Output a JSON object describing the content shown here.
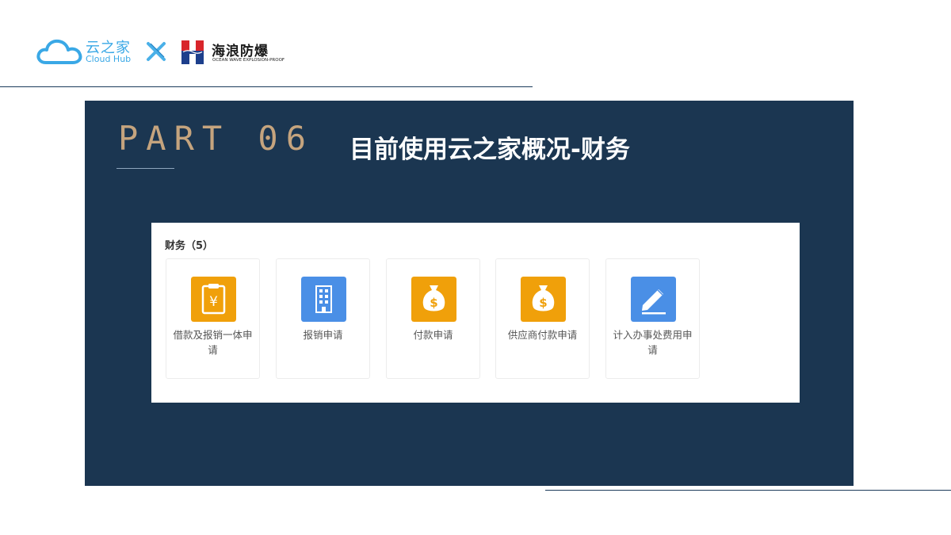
{
  "header": {
    "cloud_logo_cn": "云之家",
    "cloud_logo_en": "Cloud Hub",
    "partner_cn": "海浪防爆",
    "partner_en": "OCEAN WAVE EXPLOSION-PROOF"
  },
  "slide": {
    "part": "PART 06",
    "title": "目前使用云之家概况-财务"
  },
  "finance": {
    "section_title": "财务（5）",
    "apps": [
      {
        "label": "借款及报销一体申请",
        "icon": "clipboard-yen-icon",
        "color": "#f0a00a"
      },
      {
        "label": "报销申请",
        "icon": "building-icon",
        "color": "#4a8fe6"
      },
      {
        "label": "付款申请",
        "icon": "money-bag-icon",
        "color": "#f0a00a"
      },
      {
        "label": "供应商付款申请",
        "icon": "money-bag-icon",
        "color": "#f0a00a"
      },
      {
        "label": "计入办事处费用申请",
        "icon": "pen-edit-icon",
        "color": "#4a8fe6"
      }
    ]
  },
  "colors": {
    "panel": "#1b3651",
    "part_text": "#c5a47e",
    "cloud_blue": "#3aa8e6"
  }
}
